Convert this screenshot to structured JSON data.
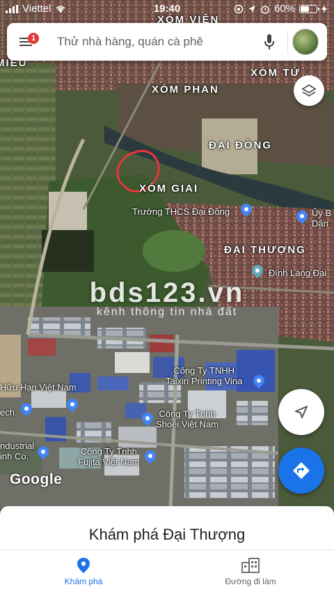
{
  "status_bar": {
    "carrier": "Viettel",
    "time": "19:40",
    "battery_percent": "60%",
    "battery_level": 0.6
  },
  "search": {
    "placeholder": "Thử nhà hàng, quán cà phê",
    "notification_count": "1"
  },
  "map_labels": [
    {
      "id": "xom-vien",
      "text": "XÓM VIÊN"
    },
    {
      "id": "xom-mieu",
      "text": "MIẾU"
    },
    {
      "id": "xom-tu",
      "text": "XÓM TỨ"
    },
    {
      "id": "xom-phan",
      "text": "XÓM PHAN"
    },
    {
      "id": "dai-dong",
      "text": "ĐẠI ĐỒNG"
    },
    {
      "id": "xom-giai",
      "text": "XÓM GIAI"
    },
    {
      "id": "dai-thuong",
      "text": "ĐẠI THƯỢNG"
    }
  ],
  "pois": {
    "truong": "Trường THCS Đại Đồng",
    "uy_ban": "Ủy B\nDân",
    "dinh_lang": "Đình Làng Đại",
    "taixin": "Công Ty TNHH\nTaixin Printing Vina",
    "huu_han": "Hữu Hạn Việt Nam",
    "ech": "ech",
    "shoei": "Công Ty Tnhh\nShoei Việt Nam",
    "industrial": "ndustrial\ninh Co.",
    "fujita": "Công Ty Tnhh\nFujita Việt Nam"
  },
  "watermark": {
    "main": "bds123.vn",
    "sub": "kênh thông tin nhà đất"
  },
  "google_logo": "Google",
  "bottom_sheet": {
    "title": "Khám phá Đại Thượng",
    "tabs": [
      {
        "label": "Khám phá",
        "icon": "location-pin-icon",
        "active": true
      },
      {
        "label": "Đường đi làm",
        "icon": "commute-building-icon",
        "active": false
      }
    ]
  },
  "colors": {
    "accent": "#1a73e8",
    "poi_pin_blue": "#4285f4",
    "poi_pin_teal": "#5fa9b8",
    "badge": "#e53935",
    "annotation_circle": "#e8353b"
  }
}
